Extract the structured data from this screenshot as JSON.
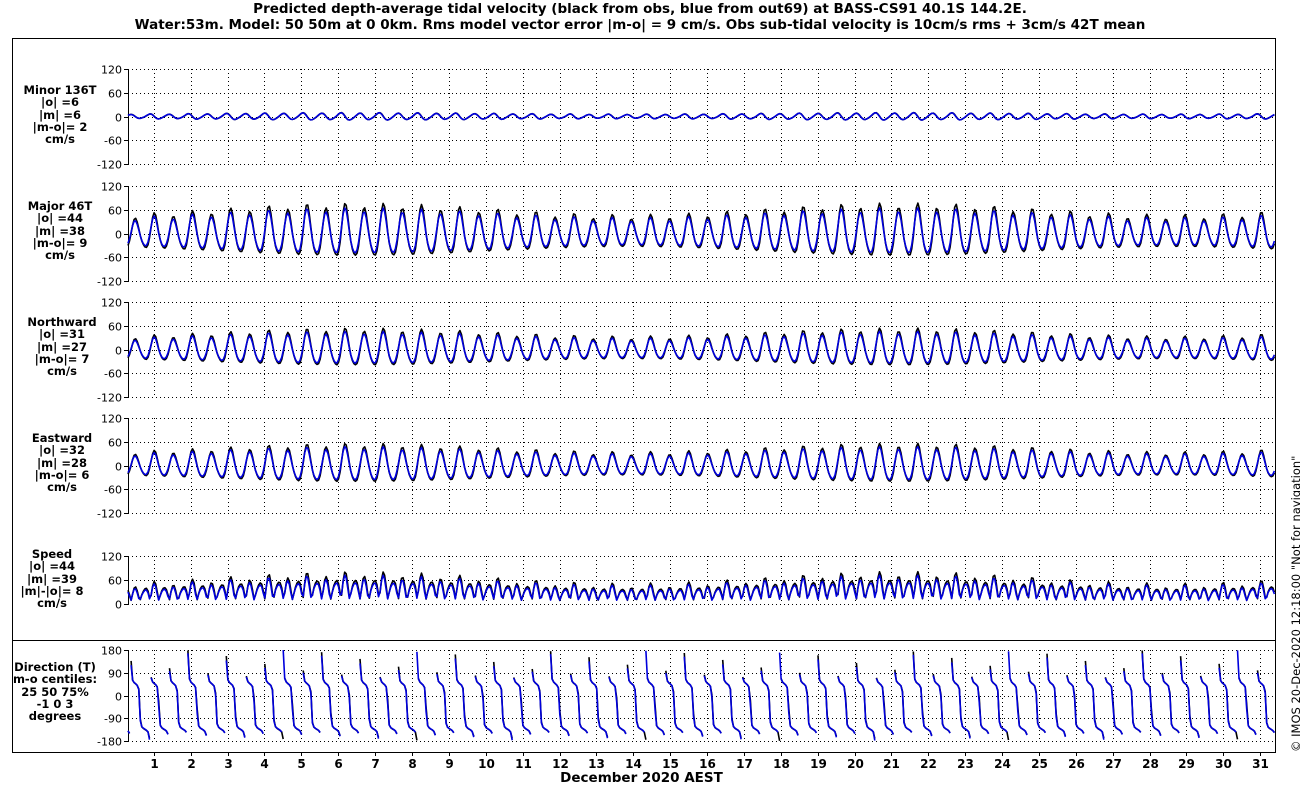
{
  "title_line1": "Predicted depth-average tidal velocity (black from obs, blue from out69) at BASS-CS91 40.1S 144.2E.",
  "title_line2": "Water:53m. Model: 50 50m at 0 0km. Rms model vector error |m-o| = 9 cm/s. Obs sub-tidal velocity is 10cm/s rms + 3cm/s 42T mean",
  "xlabel": "December 2020 AEST",
  "side_note": "© IMOS 20-Dec-2020 12:18:00  \"Not for navigation\"",
  "colors": {
    "obs": "#000000",
    "model": "#0000dd"
  },
  "chart_data": {
    "type": "line",
    "series_legend": "black from obs, blue from out69",
    "x": {
      "label": "December 2020 AEST",
      "range_days": [
        0.3,
        31.4
      ],
      "ticks": [
        "1",
        "2",
        "3",
        "4",
        "5",
        "6",
        "7",
        "8",
        "9",
        "10",
        "11",
        "12",
        "13",
        "14",
        "15",
        "16",
        "17",
        "18",
        "19",
        "20",
        "21",
        "22",
        "23",
        "24",
        "25",
        "26",
        "27",
        "28",
        "29",
        "30",
        "31"
      ]
    },
    "panels": [
      {
        "id": "minor",
        "label_lines": [
          "Minor 136T",
          "|o| =6",
          "|m| =6",
          "|m-o|= 2",
          "cm/s"
        ],
        "ylim": [
          -120,
          120
        ],
        "yticks": [
          "120",
          "60",
          "0",
          "-60",
          "-120"
        ],
        "kind": "velocity",
        "obs_amp": 6,
        "model_amp": 6,
        "phase_deg": 100,
        "rotation_deg": 136
      },
      {
        "id": "major",
        "label_lines": [
          "Major 46T",
          "|o| =44",
          "|m| =38",
          "|m-o|= 9",
          "cm/s"
        ],
        "ylim": [
          -120,
          120
        ],
        "yticks": [
          "120",
          "60",
          "0",
          "-60",
          "-120"
        ],
        "kind": "velocity",
        "obs_amp": 44,
        "model_amp": 38,
        "phase_deg": 10,
        "rotation_deg": 46
      },
      {
        "id": "north",
        "label_lines": [
          "Northward",
          "|o| =31",
          "|m| =27",
          "|m-o|= 7",
          "cm/s"
        ],
        "ylim": [
          -120,
          120
        ],
        "yticks": [
          "120",
          "60",
          "0",
          "-60",
          "-120"
        ],
        "kind": "velocity",
        "obs_amp": 31,
        "model_amp": 27,
        "phase_deg": 10,
        "rotation_deg": 0
      },
      {
        "id": "east",
        "label_lines": [
          "Eastward",
          "|o| =32",
          "|m| =28",
          "|m-o|= 6",
          "cm/s"
        ],
        "ylim": [
          -120,
          120
        ],
        "yticks": [
          "120",
          "60",
          "0",
          "-60",
          "-120"
        ],
        "kind": "velocity",
        "obs_amp": 32,
        "model_amp": 28,
        "phase_deg": 10,
        "rotation_deg": 90
      },
      {
        "id": "speed",
        "label_lines": [
          "Speed",
          "|o| =44",
          "|m| =39",
          "|m|-|o|= 8",
          "cm/s"
        ],
        "ylim": [
          0,
          120
        ],
        "yticks": [
          "120",
          "60",
          "0"
        ],
        "kind": "speed",
        "obs_amp": 44,
        "model_amp": 39
      },
      {
        "id": "direction",
        "label_lines": [
          "Direction (T)",
          "m-o centiles:",
          "25  50  75%",
          "-1  0  3",
          "degrees"
        ],
        "ylim": [
          -180,
          180
        ],
        "yticks": [
          "180",
          "90",
          "0",
          "-90",
          "-180"
        ],
        "kind": "direction"
      }
    ]
  }
}
